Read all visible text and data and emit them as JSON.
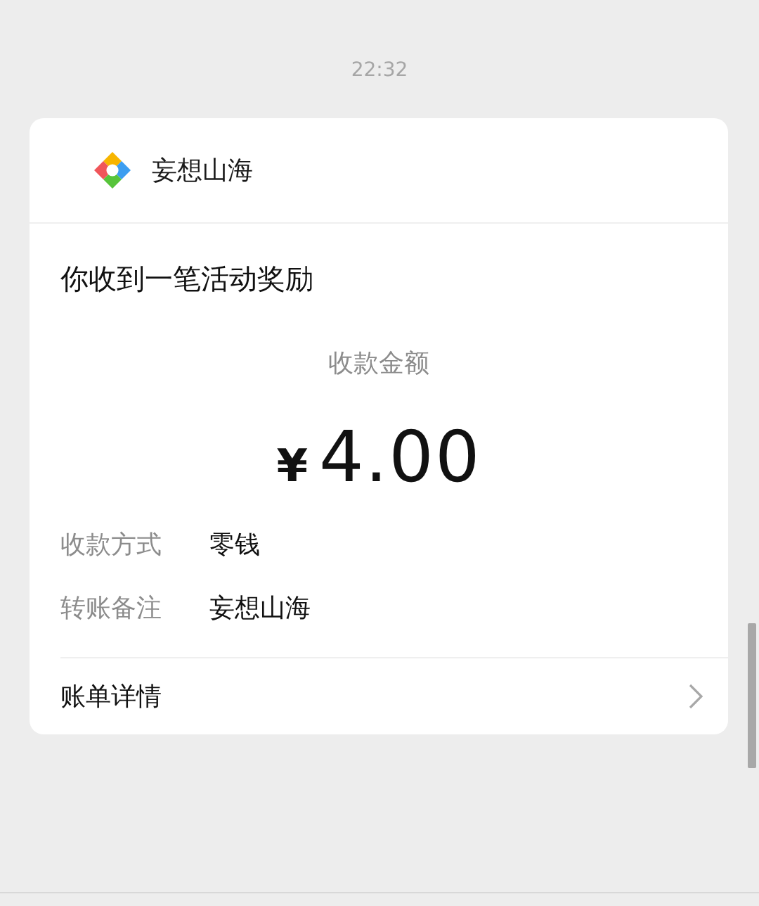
{
  "timestamp": "22:32",
  "card": {
    "app_name": "妄想山海",
    "title": "你收到一笔活动奖励",
    "amount_label": "收款金额",
    "currency": "¥",
    "amount": "4.00",
    "details": [
      {
        "label": "收款方式",
        "value": "零钱"
      },
      {
        "label": "转账备注",
        "value": "妄想山海"
      }
    ],
    "footer": {
      "label": "账单详情"
    }
  }
}
